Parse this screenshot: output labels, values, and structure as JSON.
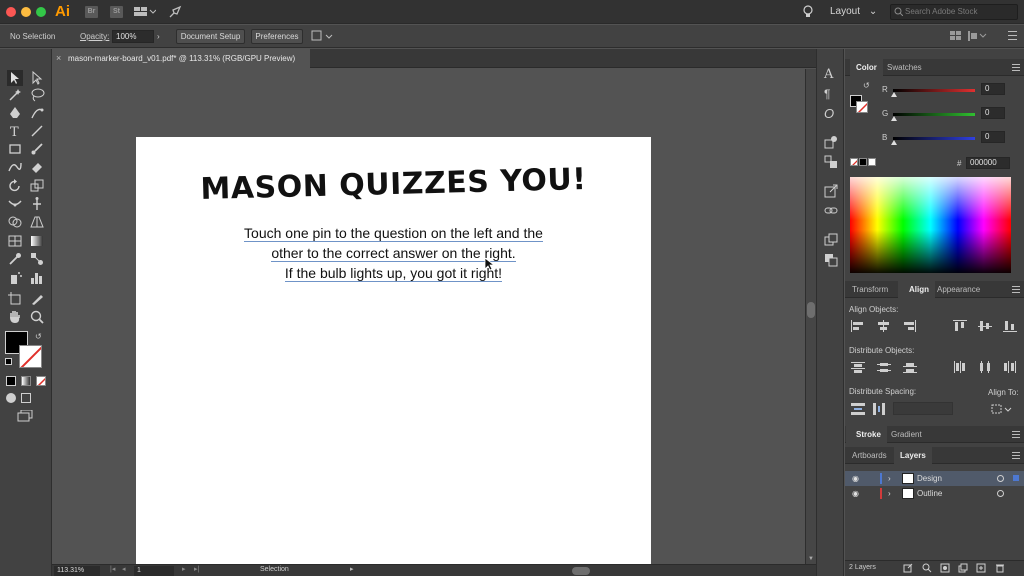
{
  "app": {
    "logo_text": "Ai",
    "chips": [
      "Br",
      "St"
    ],
    "workspace_label": "Layout",
    "search_placeholder": "Search Adobe Stock"
  },
  "colors": {
    "accent": "#ff9a00",
    "traffic_red": "#fc5753",
    "traffic_yellow": "#fdbc40",
    "traffic_green": "#33c748",
    "layer_design": "#4d78d1",
    "layer_outline": "#d13b3b"
  },
  "control_bar": {
    "selection_status": "No Selection",
    "opacity_label": "Opacity:",
    "opacity_value": "100%",
    "document_setup_label": "Document Setup",
    "preferences_label": "Preferences"
  },
  "document": {
    "tab_title": "mason-marker-board_v01.pdf* @ 113.31% (RGB/GPU Preview)",
    "close_glyph": "×",
    "headline": "MASON QUIZZES YOU!",
    "instructions": [
      "Touch one pin to the question on the left and the",
      "other to the correct answer on the right.",
      "If the bulb lights up, you got it right!"
    ]
  },
  "status_bar": {
    "zoom": "113.31%",
    "artboard_number": "1",
    "tool_name": "Selection"
  },
  "color_panel": {
    "tabs": [
      "Color",
      "Swatches"
    ],
    "active_tab": "Color",
    "channels": [
      {
        "label": "R",
        "value": "0",
        "color": "#e03030"
      },
      {
        "label": "G",
        "value": "0",
        "color": "#30c030"
      },
      {
        "label": "B",
        "value": "0",
        "color": "#3040e0"
      }
    ],
    "hex_symbol": "#",
    "hex_value": "000000"
  },
  "align_panel": {
    "tabs": [
      "Transform",
      "Align",
      "Appearance"
    ],
    "active_tab": "Align",
    "align_objects_label": "Align Objects:",
    "distribute_objects_label": "Distribute Objects:",
    "distribute_spacing_label": "Distribute Spacing:",
    "align_to_label": "Align To:"
  },
  "stroke_panel": {
    "tabs": [
      "Stroke",
      "Gradient"
    ],
    "active_tab": "Stroke"
  },
  "layers_panel": {
    "tabs": [
      "Artboards",
      "Layers"
    ],
    "active_tab": "Layers",
    "layers": [
      {
        "name": "Design",
        "selected": true
      },
      {
        "name": "Outline",
        "selected": false
      }
    ],
    "footer_count": "2 Layers"
  }
}
